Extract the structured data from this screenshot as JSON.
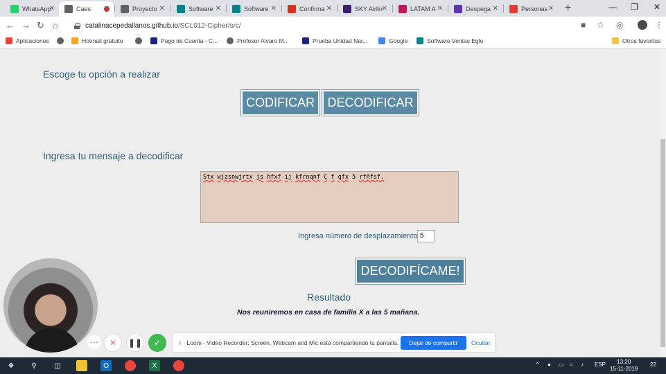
{
  "browser": {
    "tabs": [
      {
        "label": "WhatsApp",
        "icon": "whatsapp-icon",
        "color": "#25d366",
        "active": false
      },
      {
        "label": "Caes",
        "icon": "globe-icon",
        "color": "#5f6368",
        "active": true
      },
      {
        "label": "Proyecto",
        "icon": "globe-icon",
        "color": "#5f6368",
        "active": false
      },
      {
        "label": "Software",
        "icon": "flag-icon",
        "color": "#00838f",
        "active": false
      },
      {
        "label": "Software",
        "icon": "flag-icon",
        "color": "#00838f",
        "active": false
      },
      {
        "label": "Confirma",
        "icon": "gmail-icon",
        "color": "#d93025",
        "active": false
      },
      {
        "label": "SKY Airlin",
        "icon": "sky-icon",
        "color": "#3b1f6e",
        "active": false
      },
      {
        "label": "LATAM A",
        "icon": "latam-icon",
        "color": "#c2185b",
        "active": false
      },
      {
        "label": "Despega",
        "icon": "despegar-icon",
        "color": "#5e35b1",
        "active": false
      },
      {
        "label": "Personas",
        "icon": "bank-icon",
        "color": "#e53935",
        "active": false
      }
    ],
    "url_host": "catalinacepedallanos.github.io",
    "url_path": "/SCL012-Cipher/src/",
    "bookmarks": [
      {
        "label": "Aplicaciones",
        "icon": "apps-grid-icon"
      },
      {
        "label": "",
        "icon": "globe-icon"
      },
      {
        "label": "Hotmail gratuito",
        "icon": "msn-icon"
      },
      {
        "label": "",
        "icon": "globe-icon"
      },
      {
        "label": "Pago de Cuenta - C...",
        "icon": "mc-icon"
      },
      {
        "label": "Profesor Alvaro M...",
        "icon": "globe-icon"
      },
      {
        "label": "Prueba Unidad Nar...",
        "icon": "s-icon"
      },
      {
        "label": "Google",
        "icon": "google-icon"
      },
      {
        "label": "Software Ventas Eglo",
        "icon": "flag-icon"
      }
    ],
    "other_bookmarks": "Otros favoritos"
  },
  "page": {
    "choose_heading": "Escoge tu opción a realizar",
    "encode_button": "CODIFICAR",
    "decode_button": "DECODIFICAR",
    "message_heading": "Ingresa tu mensaje a decodificar",
    "message_words": [
      "Stx",
      "wjzsnwjrtx",
      "js",
      "hfxf",
      "ij",
      "kfrnqnf",
      "C",
      "f",
      "qfx",
      "5",
      "rfñfsf."
    ],
    "shift_label": "Ingresa número de desplazamiento",
    "shift_value": "5",
    "decode_me_button": "DECODIFÍCAME!",
    "result_title": "Resultado",
    "result_text": "Nos reuniremos en casa de familia X a las 5 mañana."
  },
  "loom": {
    "message": "Loom - Video Recorder: Screen, Webcam and Mic está compartiendo tu pantalla.",
    "share_button": "Dejar de compartir",
    "hide_link": "Ocultar"
  },
  "taskbar": {
    "language": "ESP",
    "time": "13:20",
    "date": "15-11-2019",
    "notifications": "22"
  }
}
